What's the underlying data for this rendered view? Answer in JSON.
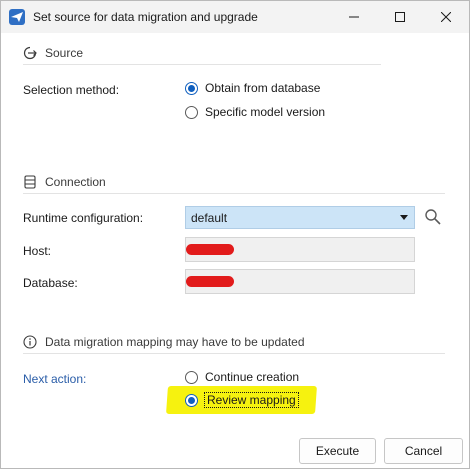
{
  "window": {
    "title": "Set source for data migration and upgrade"
  },
  "source": {
    "header": "Source",
    "selection_label": "Selection method:",
    "options": [
      {
        "label": "Obtain from database",
        "checked": true
      },
      {
        "label": "Specific model version",
        "checked": false
      }
    ]
  },
  "connection": {
    "header": "Connection",
    "runtime_label": "Runtime configuration:",
    "runtime_value": "default",
    "host_label": "Host:",
    "database_label": "Database:"
  },
  "mapping": {
    "notice": "Data migration mapping may have to be updated",
    "next_action_label": "Next action:",
    "options": [
      {
        "label": "Continue creation",
        "checked": false
      },
      {
        "label": "Review mapping",
        "checked": true
      }
    ]
  },
  "buttons": {
    "execute": "Execute",
    "cancel": "Cancel"
  },
  "colors": {
    "accent": "#0f5fbf",
    "dropdown_bg": "#cce4f7",
    "highlight": "#f6f20f",
    "redaction": "#e21b1b"
  }
}
